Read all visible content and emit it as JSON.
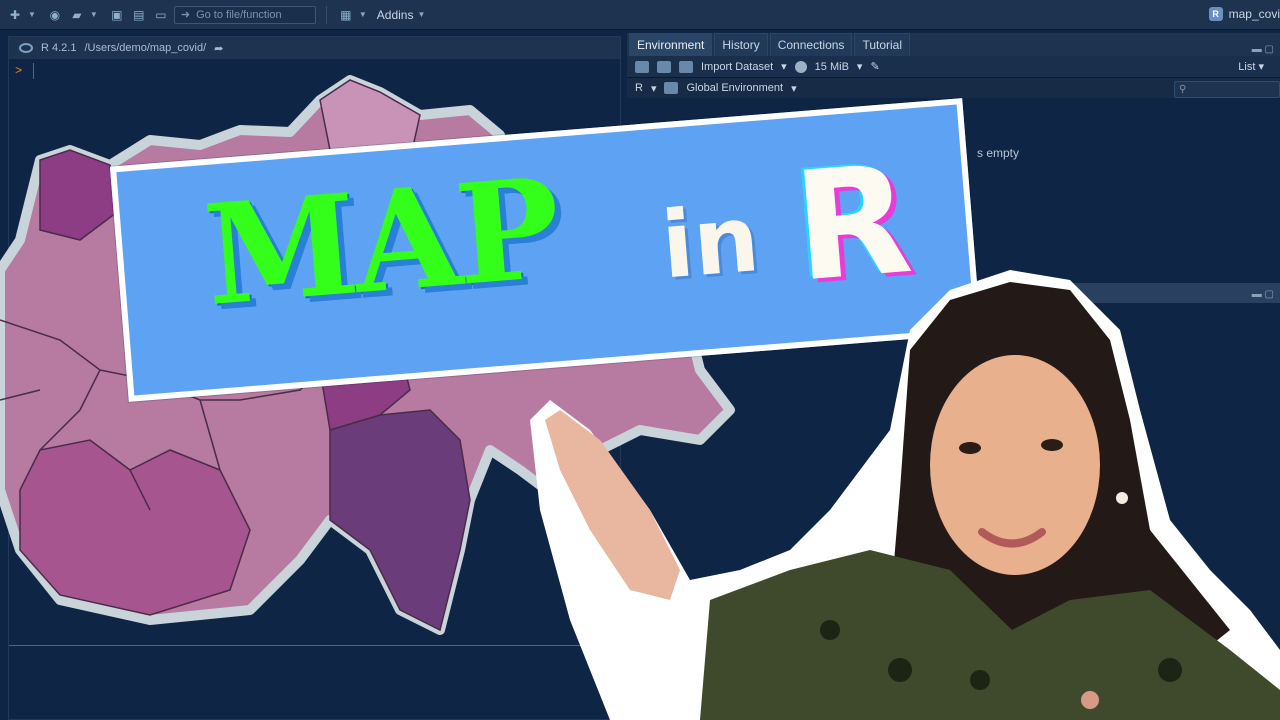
{
  "toolbar": {
    "goto_placeholder": "Go to file/function",
    "addins_label": "Addins",
    "project_name": "map_covi",
    "project_badge": "R"
  },
  "console": {
    "r_version": "R 4.2.1",
    "path": "/Users/demo/map_covid/",
    "prompt": ">"
  },
  "env_pane": {
    "tabs": [
      "Environment",
      "History",
      "Connections",
      "Tutorial"
    ],
    "active_tab": "Environment",
    "import_label": "Import Dataset",
    "memory_label": "15 MiB",
    "view_mode": "List",
    "language": "R",
    "scope": "Global Environment",
    "empty_message": "s empty"
  },
  "banner": {
    "word1": "MAP",
    "word2": "in",
    "word3": "R"
  },
  "colors": {
    "bg": "#0f2545",
    "banner_bg": "#5ea3f3",
    "map_green": "#34ff1a",
    "map_light": "#c07aa6",
    "map_dark": "#7a3f86"
  }
}
